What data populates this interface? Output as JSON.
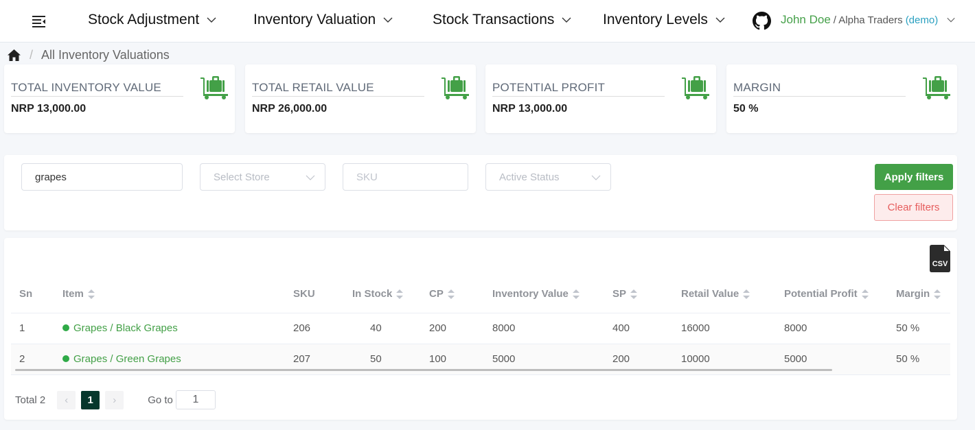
{
  "nav": {
    "items": [
      {
        "label": "Stock Adjustment"
      },
      {
        "label": "Inventory Valuation"
      },
      {
        "label": "Stock Transactions"
      },
      {
        "label": "Inventory Levels"
      }
    ],
    "user_name": "John Doe",
    "org": "/ Alpha Traders",
    "demo_tag": "(demo)"
  },
  "breadcrumb": {
    "current": "All Inventory Valuations",
    "separator": "/"
  },
  "cards": [
    {
      "title": "TOTAL INVENTORY VALUE",
      "value": "NRP 13,000.00",
      "icon": "luggage-cart-icon"
    },
    {
      "title": "TOTAL RETAIL VALUE",
      "value": "NRP 26,000.00",
      "icon": "luggage-cart-icon"
    },
    {
      "title": "POTENTIAL PROFIT",
      "value": "NRP 13,000.00",
      "icon": "luggage-cart-icon"
    },
    {
      "title": "MARGIN",
      "value": "50 %",
      "icon": "luggage-cart-icon"
    }
  ],
  "filters": {
    "search_value": "grapes",
    "store_placeholder": "Select Store",
    "sku_placeholder": "SKU",
    "status_placeholder": "Active Status",
    "apply_label": "Apply filters",
    "clear_label": "Clear filters"
  },
  "table": {
    "columns": [
      "Sn",
      "Item",
      "SKU",
      "In Stock",
      "CP",
      "Inventory Value",
      "SP",
      "Retail Value",
      "Potential Profit",
      "Margin"
    ],
    "rows": [
      {
        "sn": "1",
        "item": "Grapes / Black Grapes",
        "sku": "206",
        "in_stock": "40",
        "cp": "200",
        "inventory_value": "8000",
        "sp": "400",
        "retail_value": "16000",
        "potential_profit": "8000",
        "margin": "50 %"
      },
      {
        "sn": "2",
        "item": "Grapes / Green Grapes",
        "sku": "207",
        "in_stock": "50",
        "cp": "100",
        "inventory_value": "5000",
        "sp": "200",
        "retail_value": "10000",
        "potential_profit": "5000",
        "margin": "50 %"
      }
    ]
  },
  "pagination": {
    "total_label": "Total 2",
    "current_page": "1",
    "goto_label": "Go to",
    "goto_value": "1",
    "prev": "‹",
    "next": "›"
  },
  "colors": {
    "accent": "#43a047",
    "danger": "#e65c5c",
    "page_active": "#06372c"
  }
}
